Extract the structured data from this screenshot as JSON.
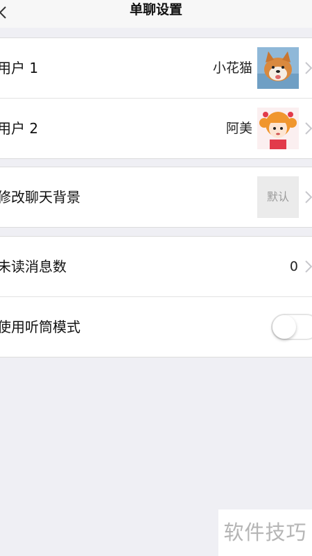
{
  "header": {
    "title": "单聊设置",
    "back_icon": "chevron-left-icon"
  },
  "users_section": {
    "user1": {
      "label": "用户 1",
      "value": "小花猫",
      "avatar": "shiba-dog-avatar"
    },
    "user2": {
      "label": "用户 2",
      "value": "阿美",
      "avatar": "cartoon-girl-avatar"
    }
  },
  "background_section": {
    "label": "修改聊天背景",
    "value": "默认"
  },
  "settings_section": {
    "unread": {
      "label": "未读消息数",
      "value": "0"
    },
    "earpiece": {
      "label": "使用听筒模式",
      "enabled": false
    }
  },
  "watermark": "软件技巧",
  "colors": {
    "background": "#efeff4",
    "row": "#ffffff",
    "chevron": "#c7c7cc"
  }
}
